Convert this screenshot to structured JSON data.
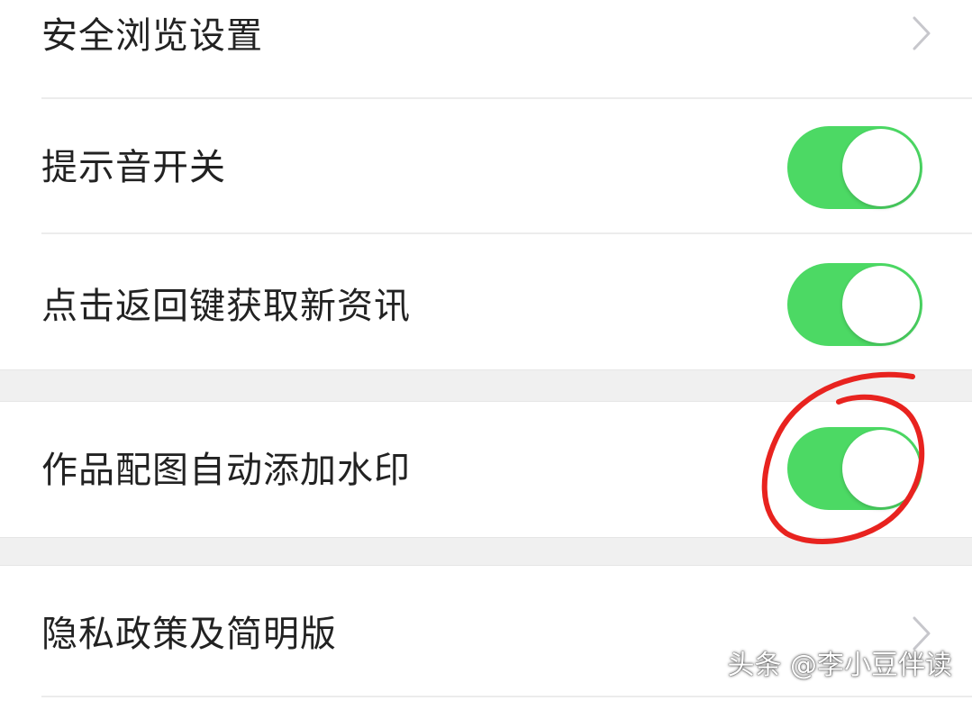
{
  "settings": {
    "items": [
      {
        "label": "安全浏览设置",
        "type": "link"
      },
      {
        "label": "提示音开关",
        "type": "toggle",
        "on": true
      },
      {
        "label": "点击返回键获取新资讯",
        "type": "toggle",
        "on": true
      },
      {
        "label": "作品配图自动添加水印",
        "type": "toggle",
        "on": true
      },
      {
        "label": "隐私政策及简明版",
        "type": "link"
      }
    ]
  },
  "colors": {
    "toggle_on": "#4cd964",
    "annotation_circle": "#e8231f",
    "divider": "#ececec",
    "section_gap": "#f0f0f0"
  },
  "icons": {
    "chevron": "chevron-right-icon"
  },
  "watermark": {
    "text": "头条 @李小豆伴读"
  }
}
